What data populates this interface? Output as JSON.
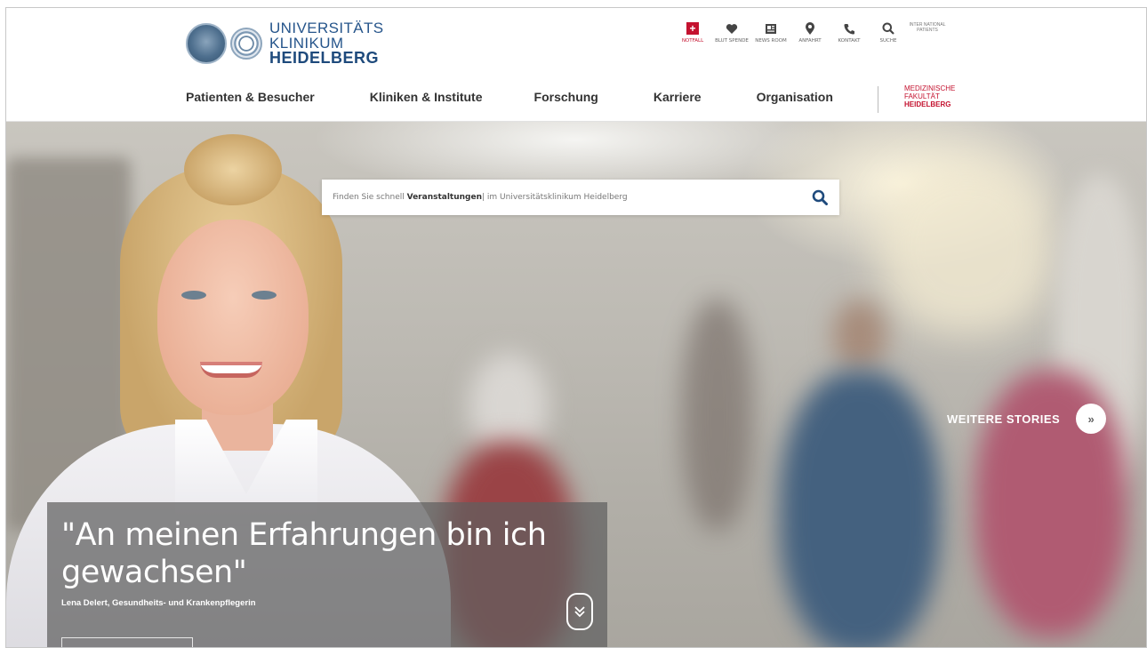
{
  "brand": {
    "line1": "UNIVERSITÄTS",
    "line2": "KLINIKUM",
    "line3": "HEIDELBERG"
  },
  "utility_nav": [
    {
      "label": "NOTFALL",
      "icon": "emergency-cross-icon"
    },
    {
      "label": "BLUT SPENDE",
      "icon": "heart-icon"
    },
    {
      "label": "NEWS ROOM",
      "icon": "newspaper-icon"
    },
    {
      "label": "ANFAHRT",
      "icon": "location-pin-icon"
    },
    {
      "label": "KONTAKT",
      "icon": "phone-icon"
    },
    {
      "label": "SUCHE",
      "icon": "search-icon"
    },
    {
      "label": "INTER NATIONAL PATIENTS",
      "icon": "international-icon"
    }
  ],
  "main_nav": [
    "Patienten & Besucher",
    "Kliniken & Institute",
    "Forschung",
    "Karriere",
    "Organisation"
  ],
  "faculty": {
    "line1": "MEDIZINISCHE",
    "line2": "FAKULTÄT",
    "line3": "HEIDELBERG"
  },
  "search": {
    "prefix": "Finden Sie schnell ",
    "keyword": "Veranstaltungen",
    "suffix": "| im Universitätsklinikum Heidelberg"
  },
  "stories": {
    "label": "WEITERE STORIES"
  },
  "hero": {
    "quote": "\"An meinen Erfahrungen bin ich gewachsen\"",
    "caption": "Lena Delert, Gesundheits- und Krankenpflegerin"
  },
  "colors": {
    "brand_blue": "#26558b",
    "emergency_red": "#c4122f"
  }
}
